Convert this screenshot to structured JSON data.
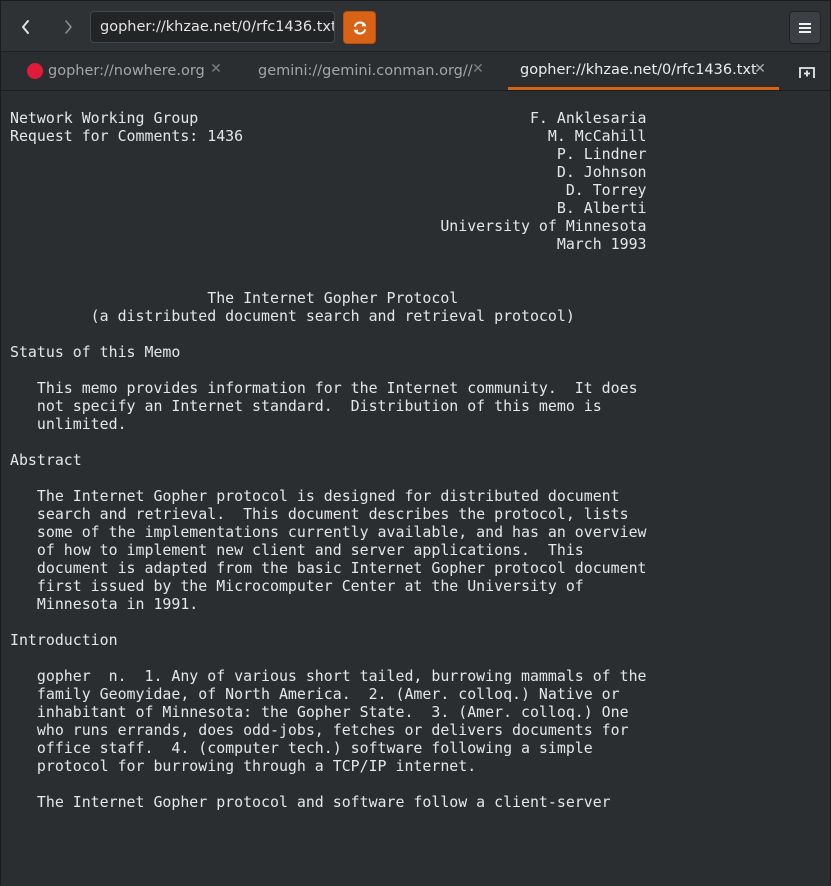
{
  "toolbar": {
    "back_icon": "chevron-left-icon",
    "forward_icon": "chevron-right-icon",
    "url": "gopher://khzae.net/0/rfc1436.txt",
    "reload_icon": "reload-icon",
    "menu_icon": "hamburger-menu-icon",
    "accent_color": "#d86216"
  },
  "tabs": [
    {
      "label": "gopher://nowhere.org",
      "status_color": "#e01b3a",
      "active": false
    },
    {
      "label": "gemini://gemini.conman.org//",
      "active": false
    },
    {
      "label": "gopher://khzae.net/0/rfc1436.txt",
      "active": true
    }
  ],
  "new_tab_icon": "new-tab-icon",
  "document": {
    "lines": [
      "Network Working Group                                     F. Anklesaria",
      "Request for Comments: 1436                                  M. McCahill",
      "                                                             P. Lindner",
      "                                                             D. Johnson",
      "                                                              D. Torrey",
      "                                                             B. Alberti",
      "                                                University of Minnesota",
      "                                                             March 1993",
      "",
      "",
      "                      The Internet Gopher Protocol",
      "         (a distributed document search and retrieval protocol)",
      "",
      "Status of this Memo",
      "",
      "   This memo provides information for the Internet community.  It does",
      "   not specify an Internet standard.  Distribution of this memo is",
      "   unlimited.",
      "",
      "Abstract",
      "",
      "   The Internet Gopher protocol is designed for distributed document",
      "   search and retrieval.  This document describes the protocol, lists",
      "   some of the implementations currently available, and has an overview",
      "   of how to implement new client and server applications.  This",
      "   document is adapted from the basic Internet Gopher protocol document",
      "   first issued by the Microcomputer Center at the University of",
      "   Minnesota in 1991.",
      "",
      "Introduction",
      "",
      "   gopher  n.  1. Any of various short tailed, burrowing mammals of the",
      "   family Geomyidae, of North America.  2. (Amer. colloq.) Native or",
      "   inhabitant of Minnesota: the Gopher State.  3. (Amer. colloq.) One",
      "   who runs errands, does odd-jobs, fetches or delivers documents for",
      "   office staff.  4. (computer tech.) software following a simple",
      "   protocol for burrowing through a TCP/IP internet.",
      "",
      "   The Internet Gopher protocol and software follow a client-server"
    ]
  }
}
